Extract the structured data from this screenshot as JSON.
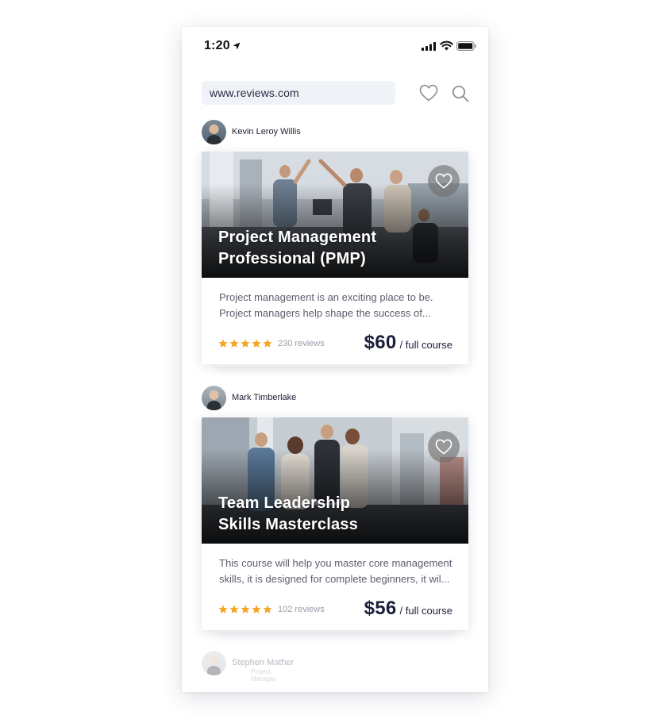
{
  "status_bar": {
    "time": "1:20"
  },
  "header": {
    "url": "www.reviews.com"
  },
  "colors": {
    "star": "#f5a623",
    "price_text": "#1c1f3a",
    "url_bar_bg": "#eff2f7"
  },
  "icons": [
    "location-arrow-icon",
    "signal-icon",
    "wifi-icon",
    "battery-icon",
    "heart-icon",
    "search-icon",
    "star-icon"
  ],
  "feed": [
    {
      "author": "Kevin Leroy Willis",
      "title_line1": "Project Management",
      "title_line2": "Professional (PMP)",
      "desc_line1": "Project management is an exciting place to be.",
      "desc_line2": "Project managers help shape the success of...",
      "rating": 5,
      "reviews": "230 reviews",
      "price": "$60",
      "price_unit": "/ full course"
    },
    {
      "author": "Mark Timberlake",
      "title_line1": "Team Leadership",
      "title_line2": "Skills Masterclass",
      "desc_line1": "This course will help you master core management",
      "desc_line2": "skills, it is designed for complete beginners, it wil...",
      "rating": 5,
      "reviews": "102 reviews",
      "price": "$56",
      "price_unit": "/ full course"
    }
  ],
  "next_author": {
    "name": "Stephen Mather",
    "role": "Project Manager"
  }
}
